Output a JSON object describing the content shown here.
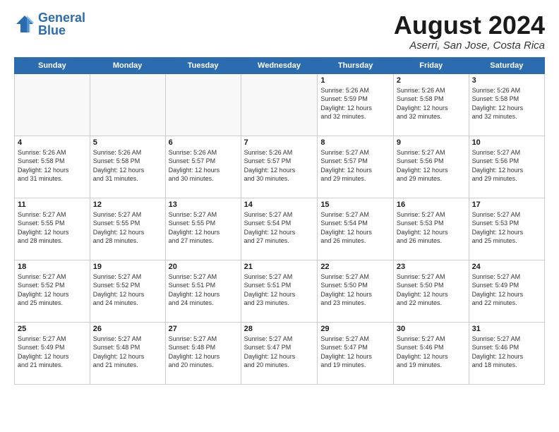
{
  "header": {
    "logo_line1": "General",
    "logo_line2": "Blue",
    "month_year": "August 2024",
    "location": "Aserri, San Jose, Costa Rica"
  },
  "weekdays": [
    "Sunday",
    "Monday",
    "Tuesday",
    "Wednesday",
    "Thursday",
    "Friday",
    "Saturday"
  ],
  "weeks": [
    [
      {
        "day": "",
        "info": ""
      },
      {
        "day": "",
        "info": ""
      },
      {
        "day": "",
        "info": ""
      },
      {
        "day": "",
        "info": ""
      },
      {
        "day": "1",
        "info": "Sunrise: 5:26 AM\nSunset: 5:59 PM\nDaylight: 12 hours\nand 32 minutes."
      },
      {
        "day": "2",
        "info": "Sunrise: 5:26 AM\nSunset: 5:58 PM\nDaylight: 12 hours\nand 32 minutes."
      },
      {
        "day": "3",
        "info": "Sunrise: 5:26 AM\nSunset: 5:58 PM\nDaylight: 12 hours\nand 32 minutes."
      }
    ],
    [
      {
        "day": "4",
        "info": "Sunrise: 5:26 AM\nSunset: 5:58 PM\nDaylight: 12 hours\nand 31 minutes."
      },
      {
        "day": "5",
        "info": "Sunrise: 5:26 AM\nSunset: 5:58 PM\nDaylight: 12 hours\nand 31 minutes."
      },
      {
        "day": "6",
        "info": "Sunrise: 5:26 AM\nSunset: 5:57 PM\nDaylight: 12 hours\nand 30 minutes."
      },
      {
        "day": "7",
        "info": "Sunrise: 5:26 AM\nSunset: 5:57 PM\nDaylight: 12 hours\nand 30 minutes."
      },
      {
        "day": "8",
        "info": "Sunrise: 5:27 AM\nSunset: 5:57 PM\nDaylight: 12 hours\nand 29 minutes."
      },
      {
        "day": "9",
        "info": "Sunrise: 5:27 AM\nSunset: 5:56 PM\nDaylight: 12 hours\nand 29 minutes."
      },
      {
        "day": "10",
        "info": "Sunrise: 5:27 AM\nSunset: 5:56 PM\nDaylight: 12 hours\nand 29 minutes."
      }
    ],
    [
      {
        "day": "11",
        "info": "Sunrise: 5:27 AM\nSunset: 5:55 PM\nDaylight: 12 hours\nand 28 minutes."
      },
      {
        "day": "12",
        "info": "Sunrise: 5:27 AM\nSunset: 5:55 PM\nDaylight: 12 hours\nand 28 minutes."
      },
      {
        "day": "13",
        "info": "Sunrise: 5:27 AM\nSunset: 5:55 PM\nDaylight: 12 hours\nand 27 minutes."
      },
      {
        "day": "14",
        "info": "Sunrise: 5:27 AM\nSunset: 5:54 PM\nDaylight: 12 hours\nand 27 minutes."
      },
      {
        "day": "15",
        "info": "Sunrise: 5:27 AM\nSunset: 5:54 PM\nDaylight: 12 hours\nand 26 minutes."
      },
      {
        "day": "16",
        "info": "Sunrise: 5:27 AM\nSunset: 5:53 PM\nDaylight: 12 hours\nand 26 minutes."
      },
      {
        "day": "17",
        "info": "Sunrise: 5:27 AM\nSunset: 5:53 PM\nDaylight: 12 hours\nand 25 minutes."
      }
    ],
    [
      {
        "day": "18",
        "info": "Sunrise: 5:27 AM\nSunset: 5:52 PM\nDaylight: 12 hours\nand 25 minutes."
      },
      {
        "day": "19",
        "info": "Sunrise: 5:27 AM\nSunset: 5:52 PM\nDaylight: 12 hours\nand 24 minutes."
      },
      {
        "day": "20",
        "info": "Sunrise: 5:27 AM\nSunset: 5:51 PM\nDaylight: 12 hours\nand 24 minutes."
      },
      {
        "day": "21",
        "info": "Sunrise: 5:27 AM\nSunset: 5:51 PM\nDaylight: 12 hours\nand 23 minutes."
      },
      {
        "day": "22",
        "info": "Sunrise: 5:27 AM\nSunset: 5:50 PM\nDaylight: 12 hours\nand 23 minutes."
      },
      {
        "day": "23",
        "info": "Sunrise: 5:27 AM\nSunset: 5:50 PM\nDaylight: 12 hours\nand 22 minutes."
      },
      {
        "day": "24",
        "info": "Sunrise: 5:27 AM\nSunset: 5:49 PM\nDaylight: 12 hours\nand 22 minutes."
      }
    ],
    [
      {
        "day": "25",
        "info": "Sunrise: 5:27 AM\nSunset: 5:49 PM\nDaylight: 12 hours\nand 21 minutes."
      },
      {
        "day": "26",
        "info": "Sunrise: 5:27 AM\nSunset: 5:48 PM\nDaylight: 12 hours\nand 21 minutes."
      },
      {
        "day": "27",
        "info": "Sunrise: 5:27 AM\nSunset: 5:48 PM\nDaylight: 12 hours\nand 20 minutes."
      },
      {
        "day": "28",
        "info": "Sunrise: 5:27 AM\nSunset: 5:47 PM\nDaylight: 12 hours\nand 20 minutes."
      },
      {
        "day": "29",
        "info": "Sunrise: 5:27 AM\nSunset: 5:47 PM\nDaylight: 12 hours\nand 19 minutes."
      },
      {
        "day": "30",
        "info": "Sunrise: 5:27 AM\nSunset: 5:46 PM\nDaylight: 12 hours\nand 19 minutes."
      },
      {
        "day": "31",
        "info": "Sunrise: 5:27 AM\nSunset: 5:46 PM\nDaylight: 12 hours\nand 18 minutes."
      }
    ]
  ]
}
